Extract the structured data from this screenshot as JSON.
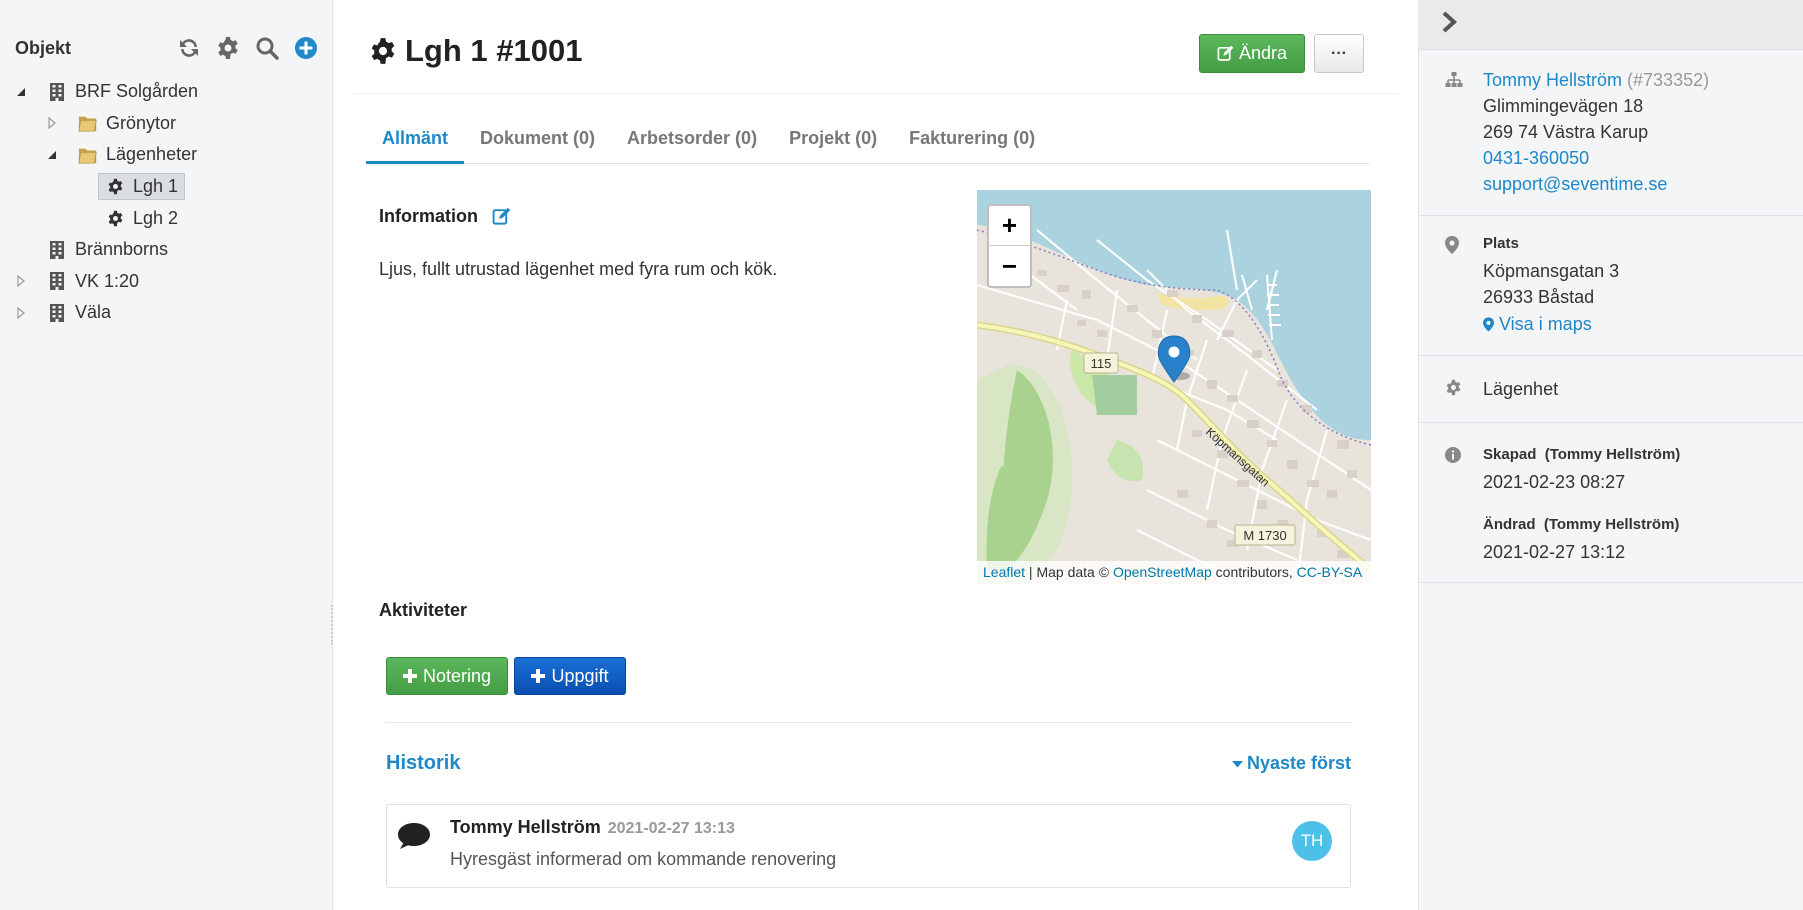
{
  "sidebar": {
    "title": "Objekt",
    "tree": [
      {
        "label": "BRF Solgården",
        "level": 0,
        "toggle": "expanded",
        "icon": "building-icon"
      },
      {
        "label": "Grönytor",
        "level": 1,
        "toggle": "collapsed",
        "icon": "folder-icon"
      },
      {
        "label": "Lägenheter",
        "level": 1,
        "toggle": "expanded",
        "icon": "folder-icon"
      },
      {
        "label": "Lgh 1",
        "level": 2,
        "toggle": "none",
        "icon": "gear-icon",
        "selected": true
      },
      {
        "label": "Lgh 2",
        "level": 2,
        "toggle": "none",
        "icon": "gear-icon"
      },
      {
        "label": "Brännborns",
        "level": 0,
        "toggle": "none",
        "icon": "building-icon"
      },
      {
        "label": "VK 1:20",
        "level": 0,
        "toggle": "collapsed",
        "icon": "building-icon"
      },
      {
        "label": "Väla",
        "level": 0,
        "toggle": "collapsed",
        "icon": "building-icon"
      }
    ]
  },
  "header": {
    "title": "Lgh 1 #1001",
    "edit_label": "Ändra",
    "more_label": "···"
  },
  "tabs": [
    {
      "label": "Allmänt",
      "active": true
    },
    {
      "label": "Dokument (0)"
    },
    {
      "label": "Arbetsorder (0)"
    },
    {
      "label": "Projekt (0)"
    },
    {
      "label": "Fakturering (0)"
    }
  ],
  "info": {
    "title": "Information",
    "text": "Ljus, fullt utrustad lägenhet med fyra rum och kök."
  },
  "map": {
    "zoom_in": "+",
    "zoom_out": "−",
    "road_label_1": "115",
    "road_label_2": "Köpmansgatan",
    "road_label_3": "M 1730",
    "attr_leaflet": "Leaflet",
    "attr_mid": " | Map data © ",
    "attr_osm": "OpenStreetMap",
    "attr_contrib": " contributors, ",
    "attr_license": "CC-BY-SA"
  },
  "activities": {
    "title": "Aktiviteter",
    "note_button": "Notering",
    "task_button": "Uppgift"
  },
  "history": {
    "title": "Historik",
    "sort_label": "Nyaste först",
    "entries": [
      {
        "author": "Tommy Hellström",
        "time": "2021-02-27 13:13",
        "text": "Hyresgäst informerad om kommande renovering",
        "initials": "TH"
      }
    ]
  },
  "right": {
    "owner": {
      "name": "Tommy Hellström",
      "id": "(#733352)",
      "address1": "Glimmingevägen 18",
      "address2": "269 74 Västra Karup",
      "phone": "0431-360050",
      "email": "support@seventime.se"
    },
    "place": {
      "label": "Plats",
      "address1": "Köpmansgatan 3",
      "address2": "26933 Båstad",
      "maps_link": "Visa i maps"
    },
    "type": "Lägenhet",
    "created": {
      "label": "Skapad",
      "by": "(Tommy Hellström)",
      "date": "2021-02-23 08:27"
    },
    "changed": {
      "label": "Ändrad",
      "by": "(Tommy Hellström)",
      "date": "2021-02-27 13:12"
    }
  },
  "colors": {
    "accent": "#1e88c8",
    "green": "#4cae4c",
    "blue": "#0b4fb0",
    "avatar": "#4cc0e8"
  }
}
